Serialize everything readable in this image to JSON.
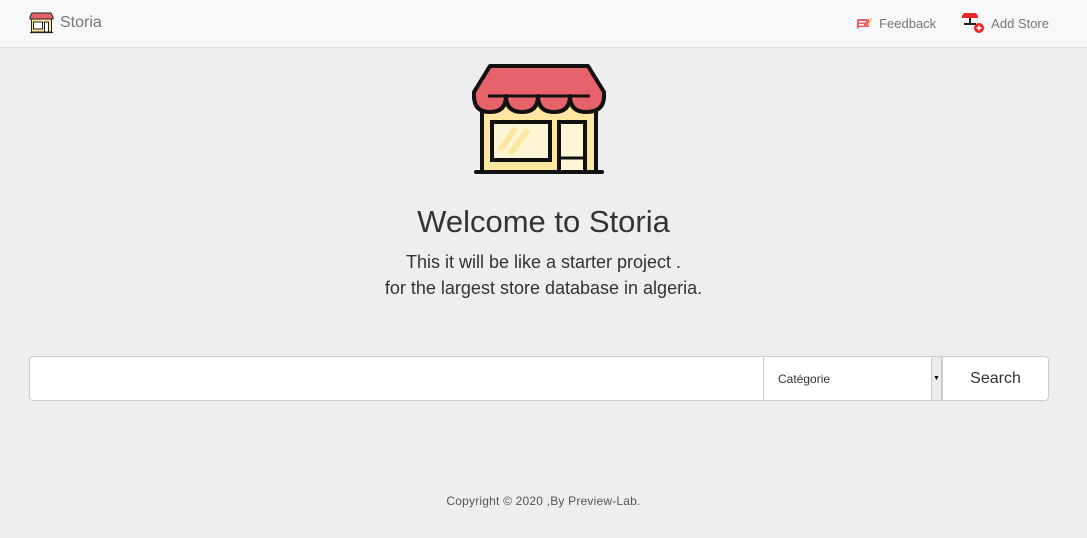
{
  "navbar": {
    "brand_label": "Storia",
    "brand_icon": "storefront-icon",
    "links": [
      {
        "label": "Feedback",
        "icon": "feedback-icon"
      },
      {
        "label": "Add Store",
        "icon": "add-store-icon"
      }
    ]
  },
  "hero": {
    "icon": "storefront-icon",
    "title": "Welcome to Storia",
    "subtitle_line1": "This it will be like a starter project .",
    "subtitle_line2": "for the largest store database in algeria."
  },
  "search": {
    "input_value": "",
    "input_placeholder": "",
    "category_selected": "Catégorie",
    "button_label": "Search"
  },
  "footer": {
    "copyright": "Copyright © 2020 ,By Preview-Lab."
  },
  "colors": {
    "awning_red": "#e8626b",
    "store_cream": "#fde7a0",
    "outline": "#111111",
    "background": "#eeeeee",
    "navbar": "#f8f8f8"
  }
}
